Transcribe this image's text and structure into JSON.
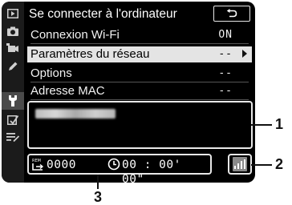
{
  "menu": {
    "title": "Se connecter à l'ordinateur",
    "rows": [
      {
        "label": "Connexion Wi-Fi",
        "value": "ON"
      },
      {
        "label": "Paramètres du réseau",
        "value": "--"
      },
      {
        "label": "Options",
        "value": "--"
      },
      {
        "label": "Adresse MAC",
        "value": "--"
      }
    ]
  },
  "rail_icons": [
    "playback-icon",
    "camera-icon",
    "movie-icon",
    "pencil-icon",
    "wrench-icon",
    "retouch-icon",
    "my-menu-icon"
  ],
  "status": {
    "count": "0000",
    "time": "00 : 00' 00\""
  },
  "callouts": [
    "1",
    "2",
    "3"
  ],
  "colors": {
    "background": "#000000",
    "selected_row": "#e4e4e4",
    "rail": "#1b1b1b",
    "signal": "#8a8a8a"
  }
}
